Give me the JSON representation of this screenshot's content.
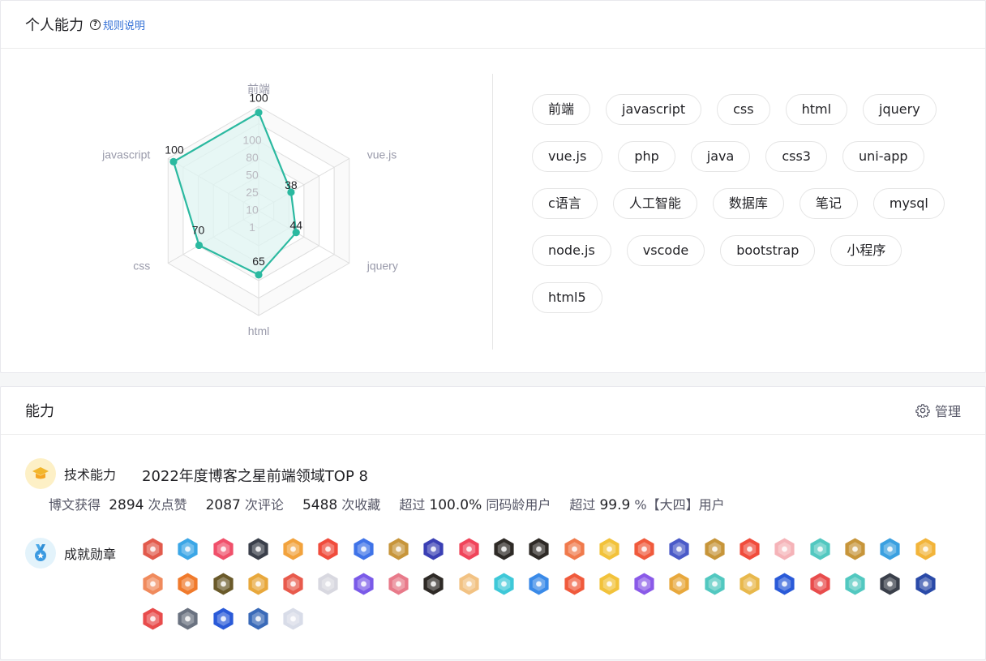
{
  "ability_card": {
    "title": "个人能力",
    "rule_link": "规则说明"
  },
  "chart_data": {
    "type": "radar",
    "axes": [
      "前端",
      "vue.js",
      "jquery",
      "html",
      "css",
      "javascript"
    ],
    "values": [
      100,
      38,
      44,
      65,
      70,
      100
    ],
    "scale_labels": [
      "100",
      "80",
      "50",
      "25",
      "10",
      "1"
    ],
    "range": [
      0,
      100
    ],
    "colors": {
      "line": "#2bb9a0",
      "fill": "#dff4f1",
      "grid": "#dddddd",
      "axis_label": "#999aaa"
    }
  },
  "skill_tags": [
    "前端",
    "javascript",
    "css",
    "html",
    "jquery",
    "vue.js",
    "php",
    "java",
    "css3",
    "uni-app",
    "c语言",
    "人工智能",
    "数据库",
    "笔记",
    "mysql",
    "node.js",
    "vscode",
    "bootstrap",
    "小程序",
    "html5"
  ],
  "capability_card": {
    "title": "能力",
    "manage_label": "管理",
    "manage_icon": "gear-icon",
    "tech": {
      "label": "技术能力",
      "icon": "graduation-cap-icon",
      "title": "2022年度博客之星前端领域TOP 8",
      "stats_prefix": "博文获得",
      "likes": "2894",
      "likes_unit": "次点赞",
      "comments": "2087",
      "comments_unit": "次评论",
      "favorites": "5488",
      "favorites_unit": "次收藏",
      "exceed1_prefix": "超过",
      "exceed1_value": "100.0%",
      "exceed1_suffix": "同码龄用户",
      "exceed2_prefix": "超过",
      "exceed2_value": "99.9",
      "exceed2_suffix": "%【大四】用户"
    },
    "medals": {
      "label": "成就勋章",
      "icon": "medal-icon",
      "badge_colors": [
        "#e25a4c",
        "#3ba6e6",
        "#f0506a",
        "#3a3f4a",
        "#f2a23c",
        "#f04c3c",
        "#3f73e8",
        "#c7953a",
        "#3a3fb4",
        "#f0445a",
        "#2e2a26",
        "#2e2a26",
        "#f07a4c",
        "#f2c23a",
        "#f05a3c",
        "#4a5ac8",
        "#c7953a",
        "#f04c3c",
        "#f5b3b8",
        "#52c8c0",
        "#c7953a",
        "#3aa0e0",
        "#f2b43a",
        "#f08a5c",
        "#f07a2c",
        "#6a5a2a",
        "#e8a83c",
        "#e85a4c",
        "#d8d8e0",
        "#7a5ae8",
        "#e87a8a",
        "#2e2a26",
        "#f2c283",
        "#3ec8d8",
        "#3a8ae8",
        "#f05a3c",
        "#f2c23a",
        "#8a5ae8",
        "#e8a83c",
        "#52c8c0",
        "#e8b84c",
        "#2a5ad8",
        "#e84c4c",
        "#52c8c0",
        "#3a3f4a",
        "#2a4aa8",
        "#e84c4c",
        "#6a7280",
        "#2a5ad8",
        "#3a6ab8",
        "#d8dce8"
      ]
    }
  }
}
